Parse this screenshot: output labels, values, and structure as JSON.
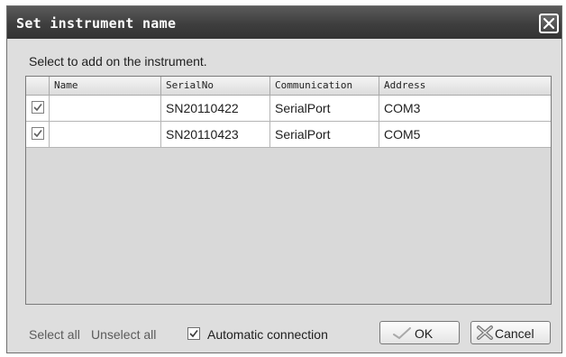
{
  "dialog": {
    "title": "Set instrument name",
    "instruction": "Select to add on the instrument."
  },
  "table": {
    "headers": {
      "name": "Name",
      "serial": "SerialNo",
      "communication": "Communication",
      "address": "Address"
    },
    "rows": [
      {
        "checked": true,
        "name": "",
        "serial": "SN20110422",
        "communication": "SerialPort",
        "address": "COM3"
      },
      {
        "checked": true,
        "name": "",
        "serial": "SN20110423",
        "communication": "SerialPort",
        "address": "COM5"
      }
    ]
  },
  "footer": {
    "select_all": "Select all",
    "unselect_all": "Unselect all",
    "auto_connection": "Automatic connection",
    "auto_connection_checked": true,
    "ok": "OK",
    "cancel": "Cancel"
  }
}
